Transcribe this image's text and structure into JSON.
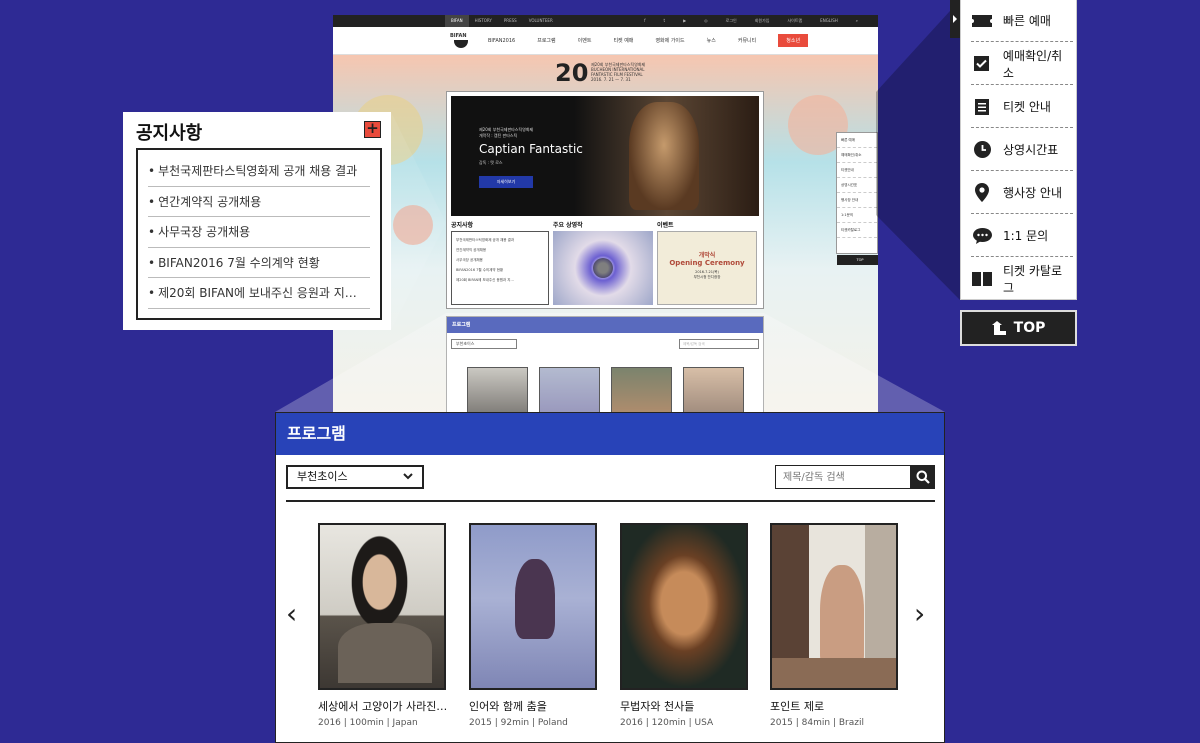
{
  "site": {
    "topbar_tabs": [
      "BIFAN",
      "HISTORY",
      "PRESS",
      "VOLUNTEER"
    ],
    "topbar_links": [
      "로그인",
      "회원가입",
      "사이트맵",
      "ENGLISH"
    ],
    "logo": "BIFAN",
    "nav": [
      "BIFAN2016",
      "프로그램",
      "이벤트",
      "티켓 예매",
      "영화제 가이드",
      "뉴스",
      "커뮤니티"
    ],
    "nav_badge": "청소년",
    "hero_number": "20",
    "hero_subtitle_lines": [
      "제20회 부천국제판타스틱영화제",
      "BUCHEON INTERNATIONAL",
      "FANTASTIC FILM FESTIVAL",
      "2016. 7. 21 — 7. 31"
    ],
    "feature": {
      "kicker": "제20회 부천국제판타스틱영화제",
      "kicker2": "개막작 : 캡틴 판타스틱",
      "title": "Captian Fantastic",
      "credit": "감독 : 맷 로스",
      "button": "자세히보기"
    },
    "sections": {
      "notice": "공지사항",
      "featured": "주요 상영작",
      "event": "이벤트"
    },
    "mini_notice_items": [
      "부천국제판타스틱영화제 공개 채용 결과",
      "연간계약직 공개채용",
      "사무국장 공개채용",
      "BIFAN2016 7월 수의계약 현황",
      "제20회 BIFAN에 보내주신 응원과 지..."
    ],
    "event_card": {
      "title_ko": "개막식",
      "title_en": "Opening Ceremony",
      "date": "2016.7.21(목)",
      "place": "부천시청 잔디광장"
    },
    "mini_program": {
      "title": "프로그램",
      "select": "부천초이스",
      "search": "제목/감독 검색"
    },
    "mini_side": [
      "빠른 예매",
      "예매확인/취소",
      "티켓안내",
      "상영시간표",
      "행사장 안내",
      "1:1문의",
      "티켓카탈로그"
    ],
    "mini_top": "TOP"
  },
  "notice": {
    "title": "공지사항",
    "items": [
      "부천국제판타스틱영화제 공개 채용 결과",
      "연간계약직 공개채용",
      "사무국장 공개채용",
      "BIFAN2016 7월 수의계약 현황",
      "제20회 BIFAN에 보내주신 응원과 지…"
    ]
  },
  "quick_menu": {
    "items": [
      {
        "label": "빠른 예매",
        "icon": "ticket-icon"
      },
      {
        "label": "예매확인/취소",
        "icon": "checkbox-icon"
      },
      {
        "label": "티켓 안내",
        "icon": "document-icon"
      },
      {
        "label": "상영시간표",
        "icon": "clock-icon"
      },
      {
        "label": "행사장 안내",
        "icon": "location-pin-icon"
      },
      {
        "label": "1:1 문의",
        "icon": "chat-bubble-icon"
      },
      {
        "label": "티켓 카탈로그",
        "icon": "book-icon"
      }
    ],
    "top": "TOP"
  },
  "program": {
    "title": "프로그램",
    "select_value": "부천초이스",
    "search_placeholder": "제목/감독 검색",
    "movies": [
      {
        "title": "세상에서 고양이가 사라진…",
        "meta": "2016 | 100min | Japan"
      },
      {
        "title": "인어와 함께 춤을",
        "meta": "2015 | 92min | Poland"
      },
      {
        "title": "무법자와 천사들",
        "meta": "2016 | 120min | USA"
      },
      {
        "title": "포인트 제로",
        "meta": "2015 | 84min | Brazil"
      }
    ]
  },
  "colors": {
    "background": "#2e2a94",
    "program_bar": "#2843b8",
    "accent_red": "#e94b3c",
    "dark": "#222222"
  }
}
